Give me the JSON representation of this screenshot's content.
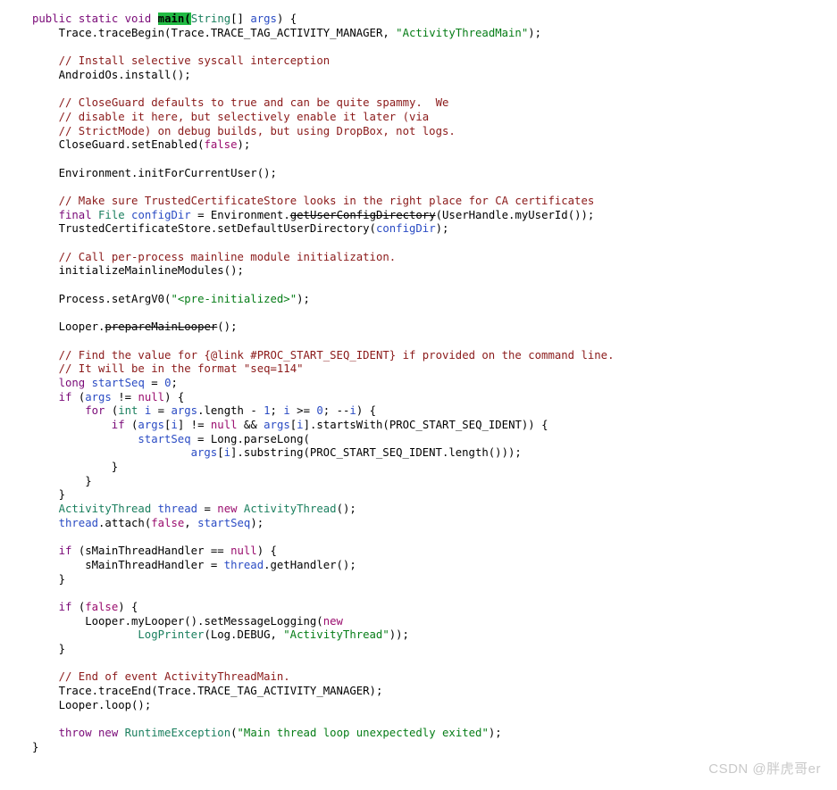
{
  "editor": {
    "language": "java",
    "background_color": "#ffffff",
    "highlight_color": "#22bb44",
    "colors": {
      "keyword": "#7a0a78",
      "type": "#1a7f5e",
      "string": "#067d17",
      "comment": "#8b1a1a",
      "identifier": "#2b4cc4",
      "plain": "#000000"
    }
  },
  "watermark": {
    "text": "CSDN @胖虎哥er"
  },
  "code": {
    "lines": [
      {
        "id": 1,
        "indent": 0,
        "tokens": [
          {
            "t": "public static void ",
            "k": "keyword"
          },
          {
            "t": "main",
            "k": "hl"
          },
          {
            "t": "(",
            "k": "hl"
          },
          {
            "t": "String",
            "k": "type"
          },
          {
            "t": "[] ",
            "k": "plain"
          },
          {
            "t": "args",
            "k": "ident"
          },
          {
            "t": ") {",
            "k": "plain"
          }
        ]
      },
      {
        "id": 2,
        "indent": 1,
        "tokens": [
          {
            "t": "Trace.traceBegin(Trace.TRACE_TAG_ACTIVITY_MANAGER, ",
            "k": "plain"
          },
          {
            "t": "\"ActivityThreadMain\"",
            "k": "string"
          },
          {
            "t": ");",
            "k": "plain"
          }
        ]
      },
      {
        "id": 3,
        "indent": 0,
        "tokens": []
      },
      {
        "id": 4,
        "indent": 1,
        "tokens": [
          {
            "t": "// Install selective syscall interception",
            "k": "comment"
          }
        ]
      },
      {
        "id": 5,
        "indent": 1,
        "tokens": [
          {
            "t": "AndroidOs.install();",
            "k": "plain"
          }
        ]
      },
      {
        "id": 6,
        "indent": 0,
        "tokens": []
      },
      {
        "id": 7,
        "indent": 1,
        "tokens": [
          {
            "t": "// CloseGuard defaults to true and can be quite spammy.  We",
            "k": "comment"
          }
        ]
      },
      {
        "id": 8,
        "indent": 1,
        "tokens": [
          {
            "t": "// disable it here, but selectively enable it later (via",
            "k": "comment"
          }
        ]
      },
      {
        "id": 9,
        "indent": 1,
        "tokens": [
          {
            "t": "// StrictMode) on debug builds, but using DropBox, not logs.",
            "k": "comment"
          }
        ]
      },
      {
        "id": 10,
        "indent": 1,
        "tokens": [
          {
            "t": "CloseGuard.setEnabled(",
            "k": "plain"
          },
          {
            "t": "false",
            "k": "kw2"
          },
          {
            "t": ");",
            "k": "plain"
          }
        ]
      },
      {
        "id": 11,
        "indent": 0,
        "tokens": []
      },
      {
        "id": 12,
        "indent": 1,
        "tokens": [
          {
            "t": "Environment.initForCurrentUser();",
            "k": "plain"
          }
        ]
      },
      {
        "id": 13,
        "indent": 0,
        "tokens": []
      },
      {
        "id": 14,
        "indent": 1,
        "tokens": [
          {
            "t": "// Make sure TrustedCertificateStore looks in the right place for CA certificates",
            "k": "comment"
          }
        ]
      },
      {
        "id": 15,
        "indent": 1,
        "tokens": [
          {
            "t": "final ",
            "k": "keyword"
          },
          {
            "t": "File ",
            "k": "type"
          },
          {
            "t": "configDir",
            "k": "ident"
          },
          {
            "t": " = Environment.",
            "k": "plain"
          },
          {
            "t": "getUserConfigDirectory",
            "k": "struck"
          },
          {
            "t": "(UserHandle.myUserId());",
            "k": "plain"
          }
        ]
      },
      {
        "id": 16,
        "indent": 1,
        "tokens": [
          {
            "t": "TrustedCertificateStore.setDefaultUserDirectory(",
            "k": "plain"
          },
          {
            "t": "configDir",
            "k": "ident"
          },
          {
            "t": ");",
            "k": "plain"
          }
        ]
      },
      {
        "id": 17,
        "indent": 0,
        "tokens": []
      },
      {
        "id": 18,
        "indent": 1,
        "tokens": [
          {
            "t": "// Call per-process mainline module initialization.",
            "k": "comment"
          }
        ]
      },
      {
        "id": 19,
        "indent": 1,
        "tokens": [
          {
            "t": "initializeMainlineModules();",
            "k": "plain"
          }
        ]
      },
      {
        "id": 20,
        "indent": 0,
        "tokens": []
      },
      {
        "id": 21,
        "indent": 1,
        "tokens": [
          {
            "t": "Process.setArgV0(",
            "k": "plain"
          },
          {
            "t": "\"<pre-initialized>\"",
            "k": "string"
          },
          {
            "t": ");",
            "k": "plain"
          }
        ]
      },
      {
        "id": 22,
        "indent": 0,
        "tokens": []
      },
      {
        "id": 23,
        "indent": 1,
        "tokens": [
          {
            "t": "Looper.",
            "k": "plain"
          },
          {
            "t": "prepareMainLooper",
            "k": "struck"
          },
          {
            "t": "();",
            "k": "plain"
          }
        ]
      },
      {
        "id": 24,
        "indent": 0,
        "tokens": []
      },
      {
        "id": 25,
        "indent": 1,
        "tokens": [
          {
            "t": "// Find the value for {@link #PROC_START_SEQ_IDENT} if provided on the command line.",
            "k": "comment"
          }
        ]
      },
      {
        "id": 26,
        "indent": 1,
        "tokens": [
          {
            "t": "// It will be in the format \"seq=114\"",
            "k": "comment"
          }
        ]
      },
      {
        "id": 27,
        "indent": 1,
        "tokens": [
          {
            "t": "long ",
            "k": "keyword"
          },
          {
            "t": "startSeq",
            "k": "ident"
          },
          {
            "t": " = ",
            "k": "plain"
          },
          {
            "t": "0",
            "k": "num"
          },
          {
            "t": ";",
            "k": "plain"
          }
        ]
      },
      {
        "id": 28,
        "indent": 1,
        "tokens": [
          {
            "t": "if ",
            "k": "keyword"
          },
          {
            "t": "(",
            "k": "plain"
          },
          {
            "t": "args",
            "k": "ident"
          },
          {
            "t": " != ",
            "k": "plain"
          },
          {
            "t": "null",
            "k": "kw2"
          },
          {
            "t": ") {",
            "k": "plain"
          }
        ]
      },
      {
        "id": 29,
        "indent": 2,
        "tokens": [
          {
            "t": "for ",
            "k": "keyword"
          },
          {
            "t": "(",
            "k": "plain"
          },
          {
            "t": "int ",
            "k": "type"
          },
          {
            "t": "i",
            "k": "ident"
          },
          {
            "t": " = ",
            "k": "plain"
          },
          {
            "t": "args",
            "k": "ident"
          },
          {
            "t": ".length - ",
            "k": "plain"
          },
          {
            "t": "1",
            "k": "num"
          },
          {
            "t": "; ",
            "k": "plain"
          },
          {
            "t": "i",
            "k": "ident"
          },
          {
            "t": " >= ",
            "k": "plain"
          },
          {
            "t": "0",
            "k": "num"
          },
          {
            "t": "; --",
            "k": "plain"
          },
          {
            "t": "i",
            "k": "ident"
          },
          {
            "t": ") {",
            "k": "plain"
          }
        ]
      },
      {
        "id": 30,
        "indent": 3,
        "tokens": [
          {
            "t": "if ",
            "k": "keyword"
          },
          {
            "t": "(",
            "k": "plain"
          },
          {
            "t": "args",
            "k": "ident"
          },
          {
            "t": "[",
            "k": "plain"
          },
          {
            "t": "i",
            "k": "ident"
          },
          {
            "t": "] != ",
            "k": "plain"
          },
          {
            "t": "null",
            "k": "kw2"
          },
          {
            "t": " && ",
            "k": "plain"
          },
          {
            "t": "args",
            "k": "ident"
          },
          {
            "t": "[",
            "k": "plain"
          },
          {
            "t": "i",
            "k": "ident"
          },
          {
            "t": "].startsWith(PROC_START_SEQ_IDENT)) {",
            "k": "plain"
          }
        ]
      },
      {
        "id": 31,
        "indent": 4,
        "tokens": [
          {
            "t": "startSeq",
            "k": "ident"
          },
          {
            "t": " = Long.parseLong(",
            "k": "plain"
          }
        ]
      },
      {
        "id": 32,
        "indent": 6,
        "tokens": [
          {
            "t": "args",
            "k": "ident"
          },
          {
            "t": "[",
            "k": "plain"
          },
          {
            "t": "i",
            "k": "ident"
          },
          {
            "t": "].substring(PROC_START_SEQ_IDENT.length()));",
            "k": "plain"
          }
        ]
      },
      {
        "id": 33,
        "indent": 3,
        "tokens": [
          {
            "t": "}",
            "k": "plain"
          }
        ]
      },
      {
        "id": 34,
        "indent": 2,
        "tokens": [
          {
            "t": "}",
            "k": "plain"
          }
        ]
      },
      {
        "id": 35,
        "indent": 1,
        "tokens": [
          {
            "t": "}",
            "k": "plain"
          }
        ]
      },
      {
        "id": 36,
        "indent": 1,
        "tokens": [
          {
            "t": "ActivityThread ",
            "k": "type"
          },
          {
            "t": "thread",
            "k": "ident"
          },
          {
            "t": " = ",
            "k": "plain"
          },
          {
            "t": "new ",
            "k": "kw2"
          },
          {
            "t": "ActivityThread",
            "k": "type"
          },
          {
            "t": "();",
            "k": "plain"
          }
        ]
      },
      {
        "id": 37,
        "indent": 1,
        "tokens": [
          {
            "t": "thread",
            "k": "ident"
          },
          {
            "t": ".attach(",
            "k": "plain"
          },
          {
            "t": "false",
            "k": "kw2"
          },
          {
            "t": ", ",
            "k": "plain"
          },
          {
            "t": "startSeq",
            "k": "ident"
          },
          {
            "t": ");",
            "k": "plain"
          }
        ]
      },
      {
        "id": 38,
        "indent": 0,
        "tokens": []
      },
      {
        "id": 39,
        "indent": 1,
        "tokens": [
          {
            "t": "if ",
            "k": "keyword"
          },
          {
            "t": "(sMainThreadHandler == ",
            "k": "plain"
          },
          {
            "t": "null",
            "k": "kw2"
          },
          {
            "t": ") {",
            "k": "plain"
          }
        ]
      },
      {
        "id": 40,
        "indent": 2,
        "tokens": [
          {
            "t": "sMainThreadHandler = ",
            "k": "plain"
          },
          {
            "t": "thread",
            "k": "ident"
          },
          {
            "t": ".getHandler();",
            "k": "plain"
          }
        ]
      },
      {
        "id": 41,
        "indent": 1,
        "tokens": [
          {
            "t": "}",
            "k": "plain"
          }
        ]
      },
      {
        "id": 42,
        "indent": 0,
        "tokens": []
      },
      {
        "id": 43,
        "indent": 1,
        "tokens": [
          {
            "t": "if ",
            "k": "keyword"
          },
          {
            "t": "(",
            "k": "plain"
          },
          {
            "t": "false",
            "k": "kw2"
          },
          {
            "t": ") {",
            "k": "plain"
          }
        ]
      },
      {
        "id": 44,
        "indent": 2,
        "tokens": [
          {
            "t": "Looper.myLooper().setMessageLogging(",
            "k": "plain"
          },
          {
            "t": "new",
            "k": "kw2"
          }
        ]
      },
      {
        "id": 45,
        "indent": 4,
        "tokens": [
          {
            "t": "LogPrinter",
            "k": "type"
          },
          {
            "t": "(Log.DEBUG, ",
            "k": "plain"
          },
          {
            "t": "\"ActivityThread\"",
            "k": "string"
          },
          {
            "t": "));",
            "k": "plain"
          }
        ]
      },
      {
        "id": 46,
        "indent": 1,
        "tokens": [
          {
            "t": "}",
            "k": "plain"
          }
        ]
      },
      {
        "id": 47,
        "indent": 0,
        "tokens": []
      },
      {
        "id": 48,
        "indent": 1,
        "tokens": [
          {
            "t": "// End of event ActivityThreadMain.",
            "k": "comment"
          }
        ]
      },
      {
        "id": 49,
        "indent": 1,
        "tokens": [
          {
            "t": "Trace.traceEnd(Trace.TRACE_TAG_ACTIVITY_MANAGER);",
            "k": "plain"
          }
        ]
      },
      {
        "id": 50,
        "indent": 1,
        "tokens": [
          {
            "t": "Looper.loop();",
            "k": "plain"
          }
        ]
      },
      {
        "id": 51,
        "indent": 0,
        "tokens": []
      },
      {
        "id": 52,
        "indent": 1,
        "tokens": [
          {
            "t": "throw new ",
            "k": "keyword"
          },
          {
            "t": "RuntimeException",
            "k": "type"
          },
          {
            "t": "(",
            "k": "plain"
          },
          {
            "t": "\"Main thread loop unexpectedly exited\"",
            "k": "string"
          },
          {
            "t": ");",
            "k": "plain"
          }
        ]
      },
      {
        "id": 53,
        "indent": 0,
        "tokens": [
          {
            "t": "}",
            "k": "plain"
          }
        ]
      }
    ]
  }
}
